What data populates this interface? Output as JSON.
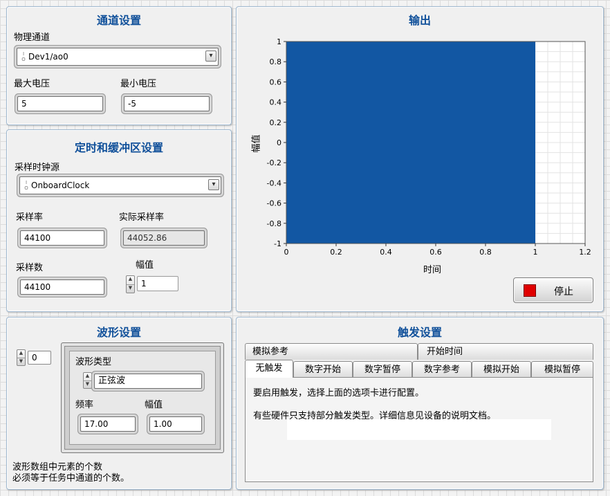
{
  "channel_panel": {
    "title": "通道设置",
    "physical_channel_label": "物理通道",
    "physical_channel_value": "Dev1/ao0",
    "max_voltage_label": "最大电压",
    "max_voltage_value": "5",
    "min_voltage_label": "最小电压",
    "min_voltage_value": "-5"
  },
  "timing_panel": {
    "title": "定时和缓冲区设置",
    "clock_source_label": "采样时钟源",
    "clock_source_value": "OnboardClock",
    "rate_label": "采样率",
    "rate_value": "44100",
    "actual_rate_label": "实际采样率",
    "actual_rate_value": "44052.86",
    "samples_label": "采样数",
    "samples_value": "44100",
    "amplitude_label": "幅值",
    "amplitude_value": "1"
  },
  "output_panel": {
    "title": "输出",
    "stop_label": "停止",
    "plot_color": "#1257a3",
    "stop_color": "#e00000"
  },
  "chart_data": {
    "type": "area",
    "title": "",
    "xlabel": "时间",
    "ylabel": "幅值",
    "xlim": [
      0,
      1.2
    ],
    "ylim": [
      -1,
      1
    ],
    "x_ticks": [
      "0",
      "0.2",
      "0.4",
      "0.6",
      "0.8",
      "1",
      "1.2"
    ],
    "y_ticks": [
      "1",
      "0.8",
      "0.6",
      "0.4",
      "0.2",
      "0",
      "-0.2",
      "-0.4",
      "-0.6",
      "-0.8",
      "-1"
    ],
    "grid": true,
    "series": [
      {
        "waveform": "sine",
        "frequency": 17,
        "amplitude": 1,
        "x_start": 0,
        "x_end": 1,
        "sample_count": 44100
      }
    ]
  },
  "waveform_panel": {
    "title": "波形设置",
    "index_value": "0",
    "type_label": "波形类型",
    "type_value": "正弦波",
    "frequency_label": "频率",
    "frequency_value": "17.00",
    "amplitude_label": "幅值",
    "amplitude_value": "1.00",
    "note_line1": "波形数组中元素的个数",
    "note_line2": "必须等于任务中通道的个数。"
  },
  "trigger_panel": {
    "title": "触发设置",
    "tabs_row1": [
      "模拟参考",
      "开始时间"
    ],
    "tabs_row2": [
      "无触发",
      "数字开始",
      "数字暂停",
      "数字参考",
      "模拟开始",
      "模拟暂停"
    ],
    "active_tab": "无触发",
    "text1": "要启用触发，选择上面的选项卡进行配置。",
    "text2": "有些硬件只支持部分触发类型。详细信息见设备的说明文档。"
  }
}
